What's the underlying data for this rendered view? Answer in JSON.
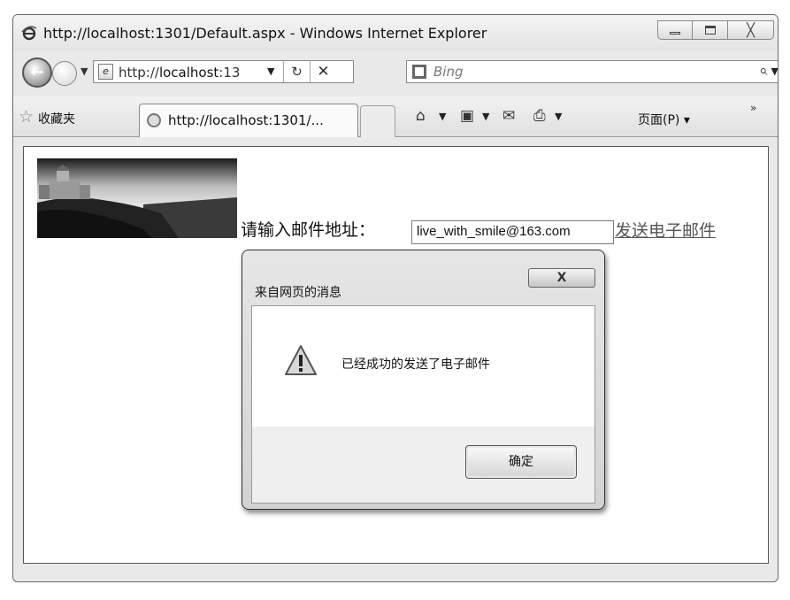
{
  "window": {
    "title": "http://localhost:1301/Default.aspx - Windows Internet Explorer",
    "close_glyph": "╳"
  },
  "addressbar": {
    "back_glyph": "←",
    "url_prefix": "http://",
    "url_host": "localhost",
    "url_rest": ":13",
    "dropdown_glyph": "▼",
    "refresh_glyph": "↻",
    "stop_glyph": "✕",
    "search_placeholder": "Bing",
    "search_glyph": "⌕"
  },
  "favbar": {
    "star_glyph": "☆",
    "favorites_label": "收藏夹",
    "tab_label": "http://localhost:1301/...",
    "home_glyph": "⌂",
    "feeds_glyph": "▣",
    "mail_glyph": "✉",
    "print_glyph": "⎙",
    "page_menu_label": "页面(P) ▾",
    "more_glyph": "»"
  },
  "page": {
    "email_label": "请输入邮件地址：",
    "email_value": "live_with_smile@163.com",
    "send_link": "发送电子邮件"
  },
  "dialog": {
    "title": "来自网页的消息",
    "close_label": "X",
    "message": "已经成功的发送了电子邮件",
    "ok_label": "确定"
  },
  "icons": {
    "browser": "ie-icon",
    "back": "back-arrow-icon",
    "forward": "forward-arrow-icon",
    "page": "page-icon",
    "refresh": "refresh-icon",
    "stop": "stop-icon",
    "bing": "bing-icon",
    "search": "search-icon",
    "favorites": "star-icon",
    "tab": "tab-loading-icon",
    "home": "home-icon",
    "feeds": "feeds-icon",
    "mail": "mail-icon",
    "print": "print-icon",
    "warning": "warning-icon"
  }
}
